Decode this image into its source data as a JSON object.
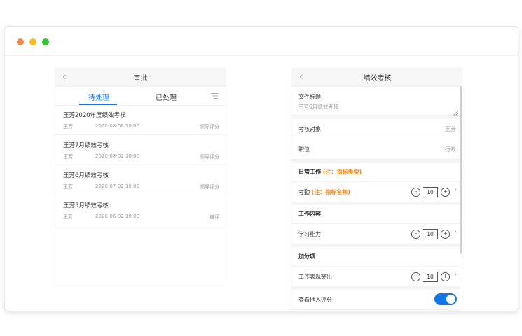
{
  "window": {
    "controls": [
      "close",
      "minimize",
      "maximize"
    ]
  },
  "left": {
    "nav_title": "审批",
    "back_icon": "chevron-left-icon",
    "tabs": [
      {
        "label": "待处理",
        "active": true
      },
      {
        "label": "已处理",
        "active": false
      }
    ],
    "filter_icon": "filter-icon",
    "items": [
      {
        "title": "王芳2020年度绩效考核",
        "user": "王芳",
        "date": "2020-08-06  10:00",
        "status": "领导评分"
      },
      {
        "title": "王芳7月绩效考核",
        "user": "王芳",
        "date": "2020-08-02  10:00",
        "status": "领导评分"
      },
      {
        "title": "王芳6月绩效考核",
        "user": "王芳",
        "date": "2020-07-02  10:00",
        "status": "领导评分"
      },
      {
        "title": "王芳5月绩效考核",
        "user": "王芳",
        "date": "2020-06-02  10:00",
        "status": "自评"
      }
    ]
  },
  "right": {
    "nav_title": "绩效考核",
    "back_icon": "chevron-left-icon",
    "doc_label": "文件标题",
    "doc_value": "王芳6月绩效考核",
    "target_label": "考核对象",
    "target_value": "王芳",
    "position_label": "职位",
    "position_value": "行政",
    "daily_work": "日常工作",
    "daily_note": "(注：指标类型)",
    "attendance_label": "考勤",
    "attendance_note": "(注：指标名称)",
    "attendance_value": "10",
    "work_content": "工作内容",
    "learning_label": "学习能力",
    "learning_value": "10",
    "bonus": "加分项",
    "performance_label": "工作表现突出",
    "performance_value": "10",
    "view_others_label": "查看他人评分",
    "view_others_on": true,
    "minus_symbol": "–",
    "plus_symbol": "+",
    "chevron_symbol": "›"
  },
  "colors": {
    "accent": "#1476e5",
    "note": "#f38a1b"
  }
}
